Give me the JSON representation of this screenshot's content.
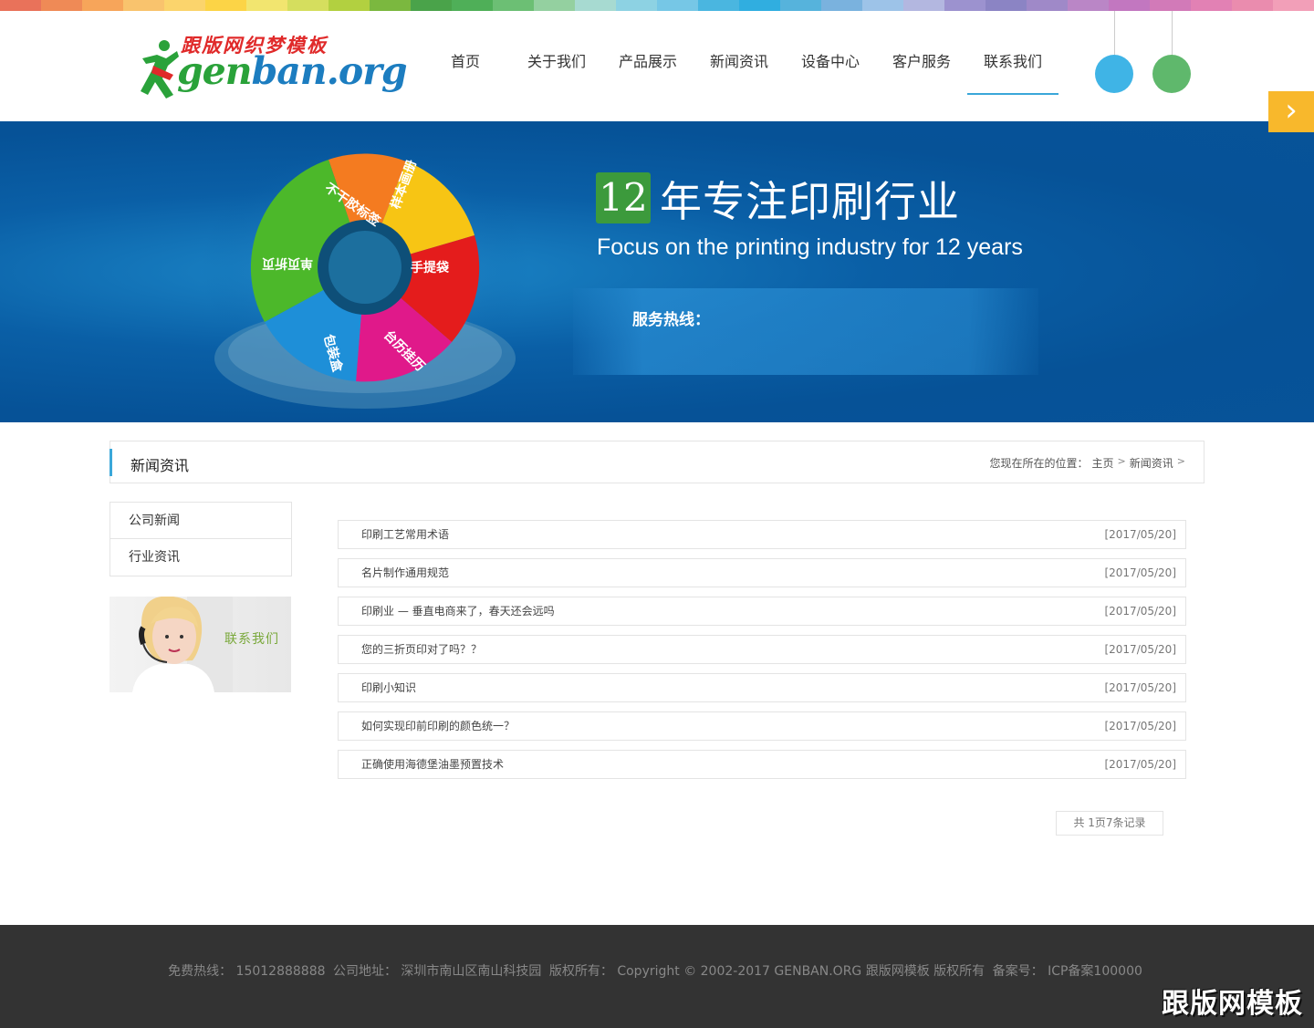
{
  "colors": {
    "rainbow": [
      "#e9725a",
      "#ef8a56",
      "#f7a55a",
      "#f9c36d",
      "#fbd46c",
      "#fcd446",
      "#f2e56f",
      "#d5de5e",
      "#b2d040",
      "#7bb83f",
      "#4aa34a",
      "#4faf58",
      "#6cbf74",
      "#94d0a0",
      "#a7dad1",
      "#8dd2e3",
      "#76c7e6",
      "#4ab6e0",
      "#30aee0",
      "#56b3dc",
      "#7ab2de",
      "#9dc3e8",
      "#b3b7e0",
      "#9c92cf",
      "#8b84c4",
      "#9f89c8",
      "#ba86c6",
      "#c277c0",
      "#d27ab8",
      "#e281b4",
      "#ea8cae",
      "#f29fb8"
    ],
    "accent": "#3aa7d9",
    "ball_blue": "#3fb4e6",
    "ball_green": "#5fb86c",
    "arrow_bg": "#f8b82c",
    "banner": "#075399"
  },
  "logo": {
    "cn": "跟版网织梦模板",
    "en_a": "gen",
    "en_b": "ban.org"
  },
  "nav": [
    {
      "label": "首页"
    },
    {
      "label": "关于我们"
    },
    {
      "label": "产品展示"
    },
    {
      "label": "新闻资讯"
    },
    {
      "label": "设备中心"
    },
    {
      "label": "客户服务"
    },
    {
      "label": "联系我们",
      "active": true
    }
  ],
  "banner": {
    "num": "12",
    "title": "年专注印刷行业",
    "subtitle": "Focus on the printing industry for 12 years",
    "hotline_label": "服务热线：",
    "puzzle_labels": [
      "不干胶标签",
      "样本画册",
      "手提袋",
      "台历挂历",
      "包装盒",
      "单页折页"
    ],
    "next_icon": "chevron-right-icon"
  },
  "section": {
    "title": "新闻资讯",
    "breadcrumb_prefix": "您现在所在的位置：",
    "crumb_home": "主页",
    "crumb_current": "新闻资讯",
    "sep": ">"
  },
  "sidebar": {
    "items": [
      {
        "label": "公司新闻"
      },
      {
        "label": "行业资讯"
      }
    ],
    "contact_label": "联系我们"
  },
  "news": [
    {
      "title": "印刷工艺常用术语",
      "date": "[2017/05/20]"
    },
    {
      "title": "名片制作通用规范",
      "date": "[2017/05/20]"
    },
    {
      "title": "印刷业 — 垂直电商来了，春天还会远吗",
      "date": "[2017/05/20]"
    },
    {
      "title": "您的三折页印对了吗？？",
      "date": "[2017/05/20]"
    },
    {
      "title": "印刷小知识",
      "date": "[2017/05/20]"
    },
    {
      "title": "如何实现印前印刷的颜色统一？",
      "date": "[2017/05/20]"
    },
    {
      "title": "正确使用海德堡油墨预置技术",
      "date": "[2017/05/20]"
    }
  ],
  "pager": {
    "text": "共 1页7条记录"
  },
  "footer": {
    "hotline": "免费热线： 15012888888",
    "address": "公司地址： 深圳市南山区南山科技园",
    "copyright": "版权所有： Copyright © 2002-2017 GENBAN.ORG 跟版网模板 版权所有",
    "icp": "备案号： ICP备案100000",
    "watermark": "跟版网模板"
  }
}
